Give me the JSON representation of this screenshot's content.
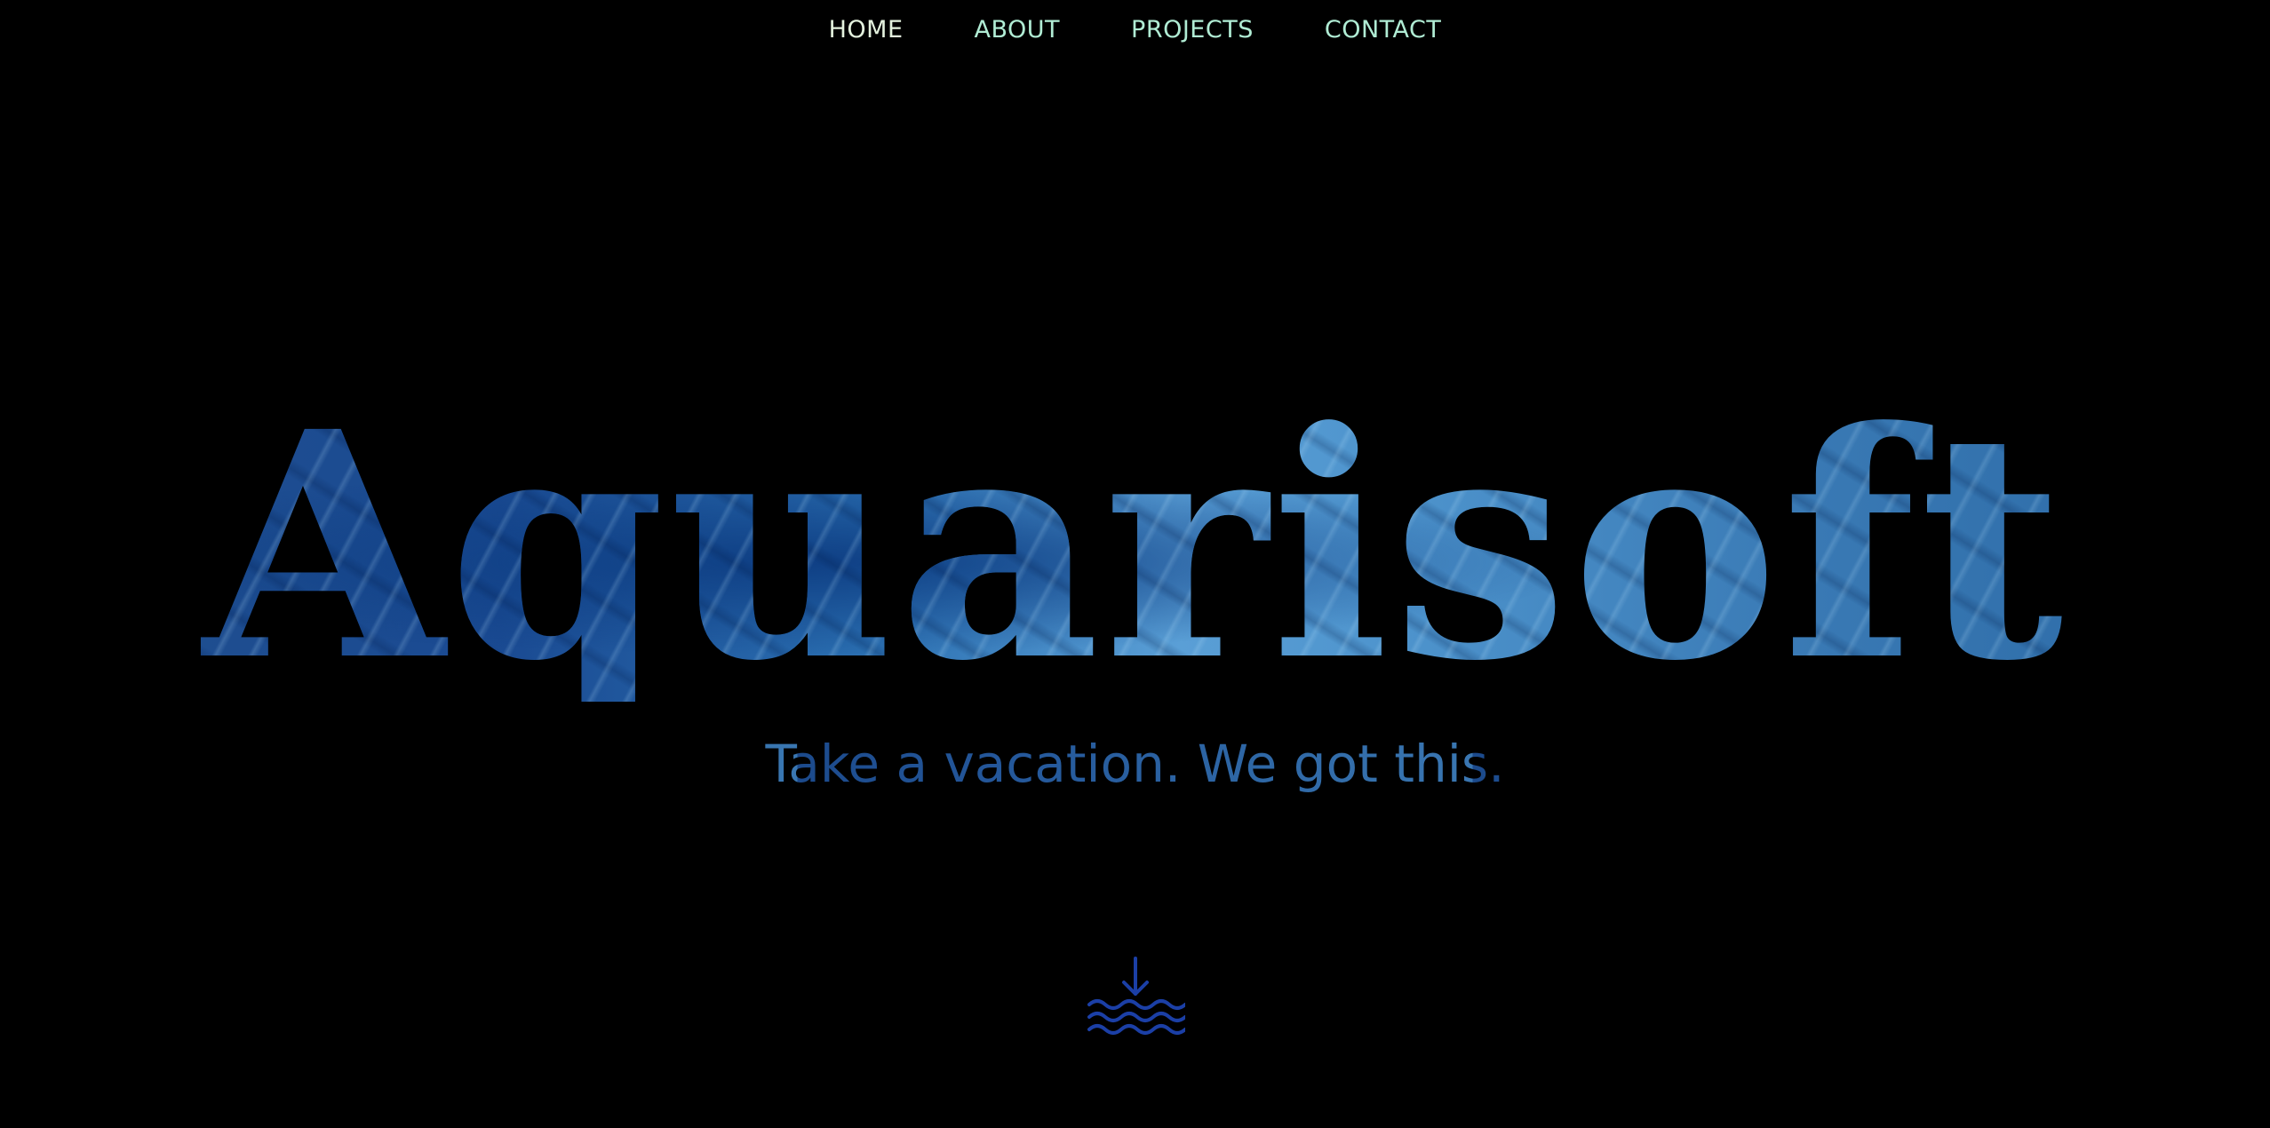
{
  "nav": {
    "items": [
      {
        "label": "HOME",
        "active": true
      },
      {
        "label": "ABOUT",
        "active": false
      },
      {
        "label": "PROJECTS",
        "active": false
      },
      {
        "label": "CONTACT",
        "active": false
      }
    ]
  },
  "hero": {
    "title": "Aquarisoft",
    "tagline": "Take a vacation. We got this.",
    "scroll_icon": "arrow-down-waves-icon"
  },
  "colors": {
    "background": "#000000",
    "nav_text": "#b0ecd4",
    "nav_active_text": "#e4f2de",
    "title_water_light": "#5a9fd6",
    "title_water_dark": "#1a4a92",
    "tagline": "#25589a",
    "icon": "#1b3fa6"
  }
}
